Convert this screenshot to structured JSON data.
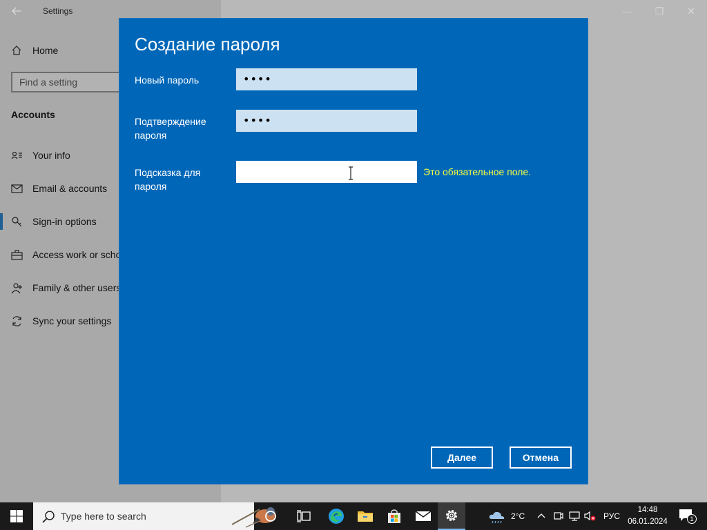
{
  "window": {
    "app_title": "Settings",
    "back_icon": "back-arrow-icon",
    "minimize_glyph": "—",
    "maximize_glyph": "❐",
    "close_glyph": "✕"
  },
  "sidebar": {
    "home_label": "Home",
    "search_placeholder": "Find a setting",
    "section_title": "Accounts",
    "items": [
      {
        "label": "Your info",
        "icon": "person-card-icon"
      },
      {
        "label": "Email & accounts",
        "icon": "mail-icon"
      },
      {
        "label": "Sign-in options",
        "icon": "key-icon",
        "selected": true
      },
      {
        "label": "Access work or scho",
        "icon": "briefcase-icon"
      },
      {
        "label": "Family & other users",
        "icon": "person-add-icon"
      },
      {
        "label": "Sync your settings",
        "icon": "sync-icon"
      }
    ]
  },
  "dialog": {
    "title": "Создание пароля",
    "fields": [
      {
        "label": "Новый пароль",
        "value": "••••"
      },
      {
        "label": "Подтверждение пароля",
        "value": "••••"
      },
      {
        "label": "Подсказка для пароля",
        "value": ""
      }
    ],
    "error_message": "Это обязательное поле.",
    "next_button": "Далее",
    "cancel_button": "Отмена",
    "accent_color": "#0067b8",
    "error_color": "#f2ff40"
  },
  "taskbar": {
    "search_placeholder": "Type here to search",
    "weather_temp": "2°C",
    "language": "РУС",
    "time": "14:48",
    "date": "06.01.2024",
    "notification_count": "1"
  }
}
